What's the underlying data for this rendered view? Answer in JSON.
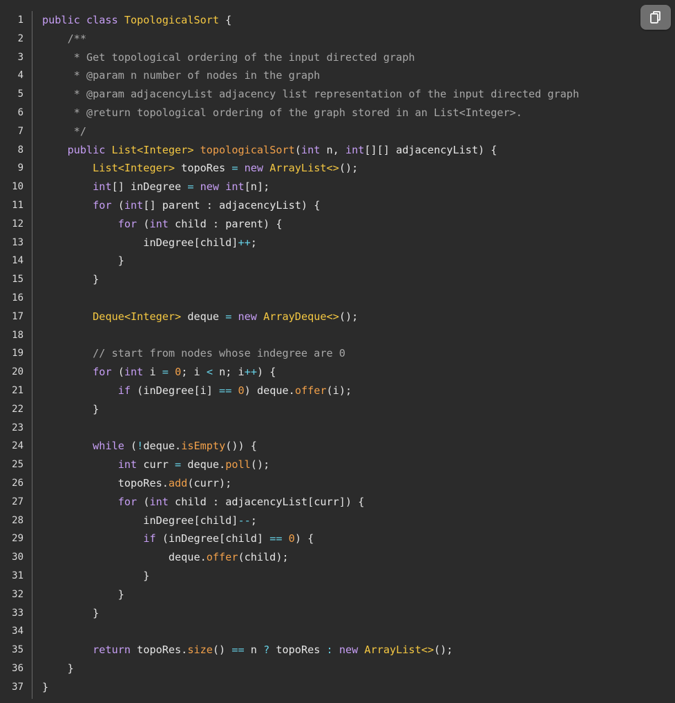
{
  "copy_button": {
    "icon": "copy-icon"
  },
  "colors": {
    "background": "#2b2b2b",
    "keyword": "#c79ff5",
    "type": "#f5c842",
    "function": "#f1a04a",
    "comment": "#a8a8a8",
    "operator": "#67d1e6",
    "text": "#e6e6e6"
  },
  "lines": [
    {
      "n": "1",
      "tokens": [
        {
          "t": "public class ",
          "c": "kw"
        },
        {
          "t": "TopologicalSort",
          "c": "type"
        },
        {
          "t": " {",
          "c": "plain"
        }
      ]
    },
    {
      "n": "2",
      "tokens": [
        {
          "t": "    /**",
          "c": "cm"
        }
      ]
    },
    {
      "n": "3",
      "tokens": [
        {
          "t": "     * Get topological ordering of the input directed graph",
          "c": "cm"
        }
      ]
    },
    {
      "n": "4",
      "tokens": [
        {
          "t": "     * @param n number of nodes in the graph",
          "c": "cm"
        }
      ]
    },
    {
      "n": "5",
      "tokens": [
        {
          "t": "     * @param adjacencyList adjacency list representation of the input directed graph",
          "c": "cm"
        }
      ]
    },
    {
      "n": "6",
      "tokens": [
        {
          "t": "     * @return topological ordering of the graph stored in an List<Integer>.",
          "c": "cm"
        }
      ]
    },
    {
      "n": "7",
      "tokens": [
        {
          "t": "     */",
          "c": "cm"
        }
      ]
    },
    {
      "n": "8",
      "tokens": [
        {
          "t": "    public ",
          "c": "kw"
        },
        {
          "t": "List<Integer> ",
          "c": "type"
        },
        {
          "t": "topologicalSort",
          "c": "fn"
        },
        {
          "t": "(",
          "c": "plain"
        },
        {
          "t": "int",
          "c": "kw"
        },
        {
          "t": " n, ",
          "c": "plain"
        },
        {
          "t": "int",
          "c": "kw"
        },
        {
          "t": "[][] adjacencyList) {",
          "c": "plain"
        }
      ]
    },
    {
      "n": "9",
      "tokens": [
        {
          "t": "        ",
          "c": "plain"
        },
        {
          "t": "List<Integer>",
          "c": "type"
        },
        {
          "t": " topoRes ",
          "c": "plain"
        },
        {
          "t": "=",
          "c": "op"
        },
        {
          "t": " ",
          "c": "plain"
        },
        {
          "t": "new ",
          "c": "kw"
        },
        {
          "t": "ArrayList<>",
          "c": "type"
        },
        {
          "t": "();",
          "c": "plain"
        }
      ]
    },
    {
      "n": "10",
      "tokens": [
        {
          "t": "        ",
          "c": "plain"
        },
        {
          "t": "int",
          "c": "kw"
        },
        {
          "t": "[] inDegree ",
          "c": "plain"
        },
        {
          "t": "=",
          "c": "op"
        },
        {
          "t": " ",
          "c": "plain"
        },
        {
          "t": "new int",
          "c": "kw"
        },
        {
          "t": "[n];",
          "c": "plain"
        }
      ]
    },
    {
      "n": "11",
      "tokens": [
        {
          "t": "        ",
          "c": "plain"
        },
        {
          "t": "for",
          "c": "kw"
        },
        {
          "t": " (",
          "c": "plain"
        },
        {
          "t": "int",
          "c": "kw"
        },
        {
          "t": "[] parent : adjacencyList) {",
          "c": "plain"
        }
      ]
    },
    {
      "n": "12",
      "tokens": [
        {
          "t": "            ",
          "c": "plain"
        },
        {
          "t": "for",
          "c": "kw"
        },
        {
          "t": " (",
          "c": "plain"
        },
        {
          "t": "int",
          "c": "kw"
        },
        {
          "t": " child : parent) {",
          "c": "plain"
        }
      ]
    },
    {
      "n": "13",
      "tokens": [
        {
          "t": "                inDegree[child]",
          "c": "plain"
        },
        {
          "t": "++",
          "c": "op"
        },
        {
          "t": ";",
          "c": "plain"
        }
      ]
    },
    {
      "n": "14",
      "tokens": [
        {
          "t": "            }",
          "c": "plain"
        }
      ]
    },
    {
      "n": "15",
      "tokens": [
        {
          "t": "        }",
          "c": "plain"
        }
      ]
    },
    {
      "n": "16",
      "tokens": [
        {
          "t": "",
          "c": "plain"
        }
      ]
    },
    {
      "n": "17",
      "tokens": [
        {
          "t": "        ",
          "c": "plain"
        },
        {
          "t": "Deque<Integer>",
          "c": "type"
        },
        {
          "t": " deque ",
          "c": "plain"
        },
        {
          "t": "=",
          "c": "op"
        },
        {
          "t": " ",
          "c": "plain"
        },
        {
          "t": "new ",
          "c": "kw"
        },
        {
          "t": "ArrayDeque<>",
          "c": "type"
        },
        {
          "t": "();",
          "c": "plain"
        }
      ]
    },
    {
      "n": "18",
      "tokens": [
        {
          "t": "",
          "c": "plain"
        }
      ]
    },
    {
      "n": "19",
      "tokens": [
        {
          "t": "        // start from nodes whose indegree are 0",
          "c": "cm"
        }
      ]
    },
    {
      "n": "20",
      "tokens": [
        {
          "t": "        ",
          "c": "plain"
        },
        {
          "t": "for",
          "c": "kw"
        },
        {
          "t": " (",
          "c": "plain"
        },
        {
          "t": "int",
          "c": "kw"
        },
        {
          "t": " i ",
          "c": "plain"
        },
        {
          "t": "=",
          "c": "op"
        },
        {
          "t": " ",
          "c": "plain"
        },
        {
          "t": "0",
          "c": "num"
        },
        {
          "t": "; i ",
          "c": "plain"
        },
        {
          "t": "<",
          "c": "op"
        },
        {
          "t": " n; i",
          "c": "plain"
        },
        {
          "t": "++",
          "c": "op"
        },
        {
          "t": ") {",
          "c": "plain"
        }
      ]
    },
    {
      "n": "21",
      "tokens": [
        {
          "t": "            ",
          "c": "plain"
        },
        {
          "t": "if",
          "c": "kw"
        },
        {
          "t": " (inDegree[i] ",
          "c": "plain"
        },
        {
          "t": "==",
          "c": "op"
        },
        {
          "t": " ",
          "c": "plain"
        },
        {
          "t": "0",
          "c": "num"
        },
        {
          "t": ") deque.",
          "c": "plain"
        },
        {
          "t": "offer",
          "c": "fn"
        },
        {
          "t": "(i);",
          "c": "plain"
        }
      ]
    },
    {
      "n": "22",
      "tokens": [
        {
          "t": "        }",
          "c": "plain"
        }
      ]
    },
    {
      "n": "23",
      "tokens": [
        {
          "t": "",
          "c": "plain"
        }
      ]
    },
    {
      "n": "24",
      "tokens": [
        {
          "t": "        ",
          "c": "plain"
        },
        {
          "t": "while",
          "c": "kw"
        },
        {
          "t": " (",
          "c": "plain"
        },
        {
          "t": "!",
          "c": "op"
        },
        {
          "t": "deque.",
          "c": "plain"
        },
        {
          "t": "isEmpty",
          "c": "fn"
        },
        {
          "t": "()) {",
          "c": "plain"
        }
      ]
    },
    {
      "n": "25",
      "tokens": [
        {
          "t": "            ",
          "c": "plain"
        },
        {
          "t": "int",
          "c": "kw"
        },
        {
          "t": " curr ",
          "c": "plain"
        },
        {
          "t": "=",
          "c": "op"
        },
        {
          "t": " deque.",
          "c": "plain"
        },
        {
          "t": "poll",
          "c": "fn"
        },
        {
          "t": "();",
          "c": "plain"
        }
      ]
    },
    {
      "n": "26",
      "tokens": [
        {
          "t": "            topoRes.",
          "c": "plain"
        },
        {
          "t": "add",
          "c": "fn"
        },
        {
          "t": "(curr);",
          "c": "plain"
        }
      ]
    },
    {
      "n": "27",
      "tokens": [
        {
          "t": "            ",
          "c": "plain"
        },
        {
          "t": "for",
          "c": "kw"
        },
        {
          "t": " (",
          "c": "plain"
        },
        {
          "t": "int",
          "c": "kw"
        },
        {
          "t": " child : adjacencyList[curr]) {",
          "c": "plain"
        }
      ]
    },
    {
      "n": "28",
      "tokens": [
        {
          "t": "                inDegree[child]",
          "c": "plain"
        },
        {
          "t": "--",
          "c": "op"
        },
        {
          "t": ";",
          "c": "plain"
        }
      ]
    },
    {
      "n": "29",
      "tokens": [
        {
          "t": "                ",
          "c": "plain"
        },
        {
          "t": "if",
          "c": "kw"
        },
        {
          "t": " (inDegree[child] ",
          "c": "plain"
        },
        {
          "t": "==",
          "c": "op"
        },
        {
          "t": " ",
          "c": "plain"
        },
        {
          "t": "0",
          "c": "num"
        },
        {
          "t": ") {",
          "c": "plain"
        }
      ]
    },
    {
      "n": "30",
      "tokens": [
        {
          "t": "                    deque.",
          "c": "plain"
        },
        {
          "t": "offer",
          "c": "fn"
        },
        {
          "t": "(child);",
          "c": "plain"
        }
      ]
    },
    {
      "n": "31",
      "tokens": [
        {
          "t": "                }",
          "c": "plain"
        }
      ]
    },
    {
      "n": "32",
      "tokens": [
        {
          "t": "            }",
          "c": "plain"
        }
      ]
    },
    {
      "n": "33",
      "tokens": [
        {
          "t": "        }",
          "c": "plain"
        }
      ]
    },
    {
      "n": "34",
      "tokens": [
        {
          "t": "",
          "c": "plain"
        }
      ]
    },
    {
      "n": "35",
      "tokens": [
        {
          "t": "        ",
          "c": "plain"
        },
        {
          "t": "return",
          "c": "kw"
        },
        {
          "t": " topoRes.",
          "c": "plain"
        },
        {
          "t": "size",
          "c": "fn"
        },
        {
          "t": "() ",
          "c": "plain"
        },
        {
          "t": "==",
          "c": "op"
        },
        {
          "t": " n ",
          "c": "plain"
        },
        {
          "t": "?",
          "c": "op"
        },
        {
          "t": " topoRes ",
          "c": "plain"
        },
        {
          "t": ":",
          "c": "op"
        },
        {
          "t": " ",
          "c": "plain"
        },
        {
          "t": "new ",
          "c": "kw"
        },
        {
          "t": "ArrayList<>",
          "c": "type"
        },
        {
          "t": "();",
          "c": "plain"
        }
      ]
    },
    {
      "n": "36",
      "tokens": [
        {
          "t": "    }",
          "c": "plain"
        }
      ]
    },
    {
      "n": "37",
      "tokens": [
        {
          "t": "}",
          "c": "plain"
        }
      ]
    }
  ]
}
